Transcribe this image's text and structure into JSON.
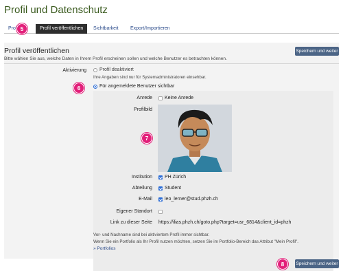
{
  "page": {
    "title": "Profil und Datenschutz"
  },
  "tabs": [
    {
      "label": "Profil"
    },
    {
      "label": "Profil veröffentlichen"
    },
    {
      "label": "Sichtbarkeit"
    },
    {
      "label": "Export/Importieren"
    }
  ],
  "badges": {
    "b5": "5",
    "b6": "6",
    "b7": "7",
    "b8": "8"
  },
  "section": {
    "title": "Profil veröffentlichen",
    "description": "Bitte wählen Sie aus, welche Daten in Ihrem Profil erscheinen sollen und welche Benutzer es betrachten können.",
    "save_label": "Speichern und weiter"
  },
  "activation": {
    "label": "Aktivierung",
    "option_disabled": "Profil deaktiviert",
    "option_disabled_hint": "Ihre Angaben sind nur für Systemadministratoren einsehbar.",
    "option_users": "Für angemeldete Benutzer sichtbar"
  },
  "fields": {
    "anrede_label": "Anrede",
    "anrede_value": "Keine Anrede",
    "profilbild_label": "Profilbild",
    "institution_label": "Institution",
    "institution_value": "PH Zürich",
    "abteilung_label": "Abteilung",
    "abteilung_value": "Student",
    "email_label": "E-Mail",
    "email_value": "leo_lerner@stud.phzh.ch",
    "standort_label": "Eigener Standort",
    "link_label": "Link zu dieser Seite",
    "link_value": "https://ilias.phzh.ch/goto.php?target=usr_6814&client_id=phzh"
  },
  "footer_note": {
    "line1": "Vor- und Nachname sind bei aktiviertem Profil immer sichtbar.",
    "line2": "Wenn Sie ein Portfolio als Ihr Profil nutzen möchten, setzen Sie im Portfolio-Bereich das Attribut \"Mein Profil\".",
    "portfolios_link": "» Portfolios"
  },
  "colors": {
    "accent_badge": "#e2207a",
    "button": "#4c6586",
    "active_tab": "#2e2e2e",
    "title": "#3a5a1e"
  }
}
